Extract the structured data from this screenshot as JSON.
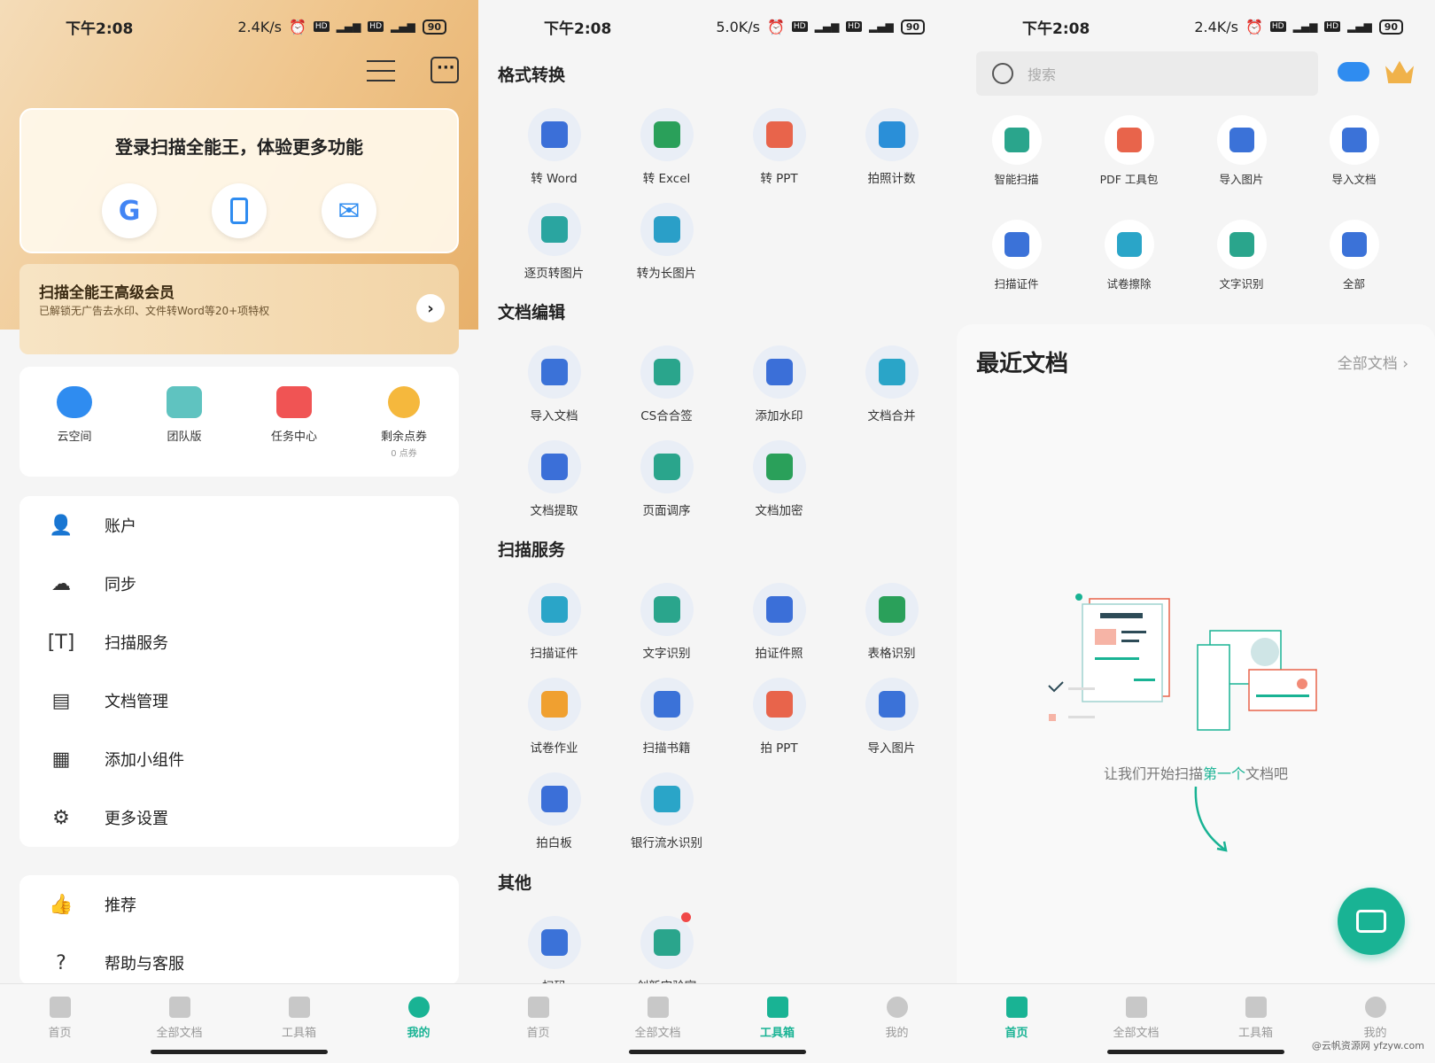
{
  "screen1": {
    "status": {
      "time": "下午2:08",
      "speed": "2.4K/s",
      "battery": "90"
    },
    "login": {
      "title": "登录扫描全能王，体验更多功能",
      "google": "G"
    },
    "vip": {
      "title": "扫描全能王高级会员",
      "subtitle": "已解锁无广告去水印、文件转Word等20+项特权"
    },
    "quick": [
      {
        "label": "云空间",
        "icon": "cloud-upload-icon",
        "color": "#2f8cf0"
      },
      {
        "label": "团队版",
        "icon": "team-folder-icon",
        "color": "#5fc3c0"
      },
      {
        "label": "任务中心",
        "icon": "task-check-icon",
        "color": "#f05454"
      },
      {
        "label": "剩余点券",
        "sub": "0 点券",
        "icon": "coupon-icon",
        "color": "#f5b83d"
      }
    ],
    "menu": [
      "账户",
      "同步",
      "扫描服务",
      "文档管理",
      "添加小组件",
      "更多设置"
    ],
    "menu2": [
      "推荐",
      "帮助与客服"
    ],
    "active_tab": "我的"
  },
  "screen2": {
    "status": {
      "time": "下午2:08",
      "speed": "5.0K/s",
      "battery": "90"
    },
    "sections": [
      {
        "title": "格式转换",
        "items": [
          {
            "label": "转 Word",
            "color": "#3b6fd8"
          },
          {
            "label": "转 Excel",
            "color": "#2aa05a"
          },
          {
            "label": "转 PPT",
            "color": "#e8644b"
          },
          {
            "label": "拍照计数",
            "color": "#2a8fd8"
          },
          {
            "label": "逐页转图片",
            "color": "#2aa5a0"
          },
          {
            "label": "转为长图片",
            "color": "#2a9fc8"
          }
        ]
      },
      {
        "title": "文档编辑",
        "items": [
          {
            "label": "导入文档",
            "color": "#3b72d8"
          },
          {
            "label": "CS合合签",
            "color": "#2aa58c"
          },
          {
            "label": "添加水印",
            "color": "#3b6fd8"
          },
          {
            "label": "文档合并",
            "color": "#2aa5c8"
          },
          {
            "label": "文档提取",
            "color": "#3b6fd8"
          },
          {
            "label": "页面调序",
            "color": "#2aa58c"
          },
          {
            "label": "文档加密",
            "color": "#2aa05a"
          }
        ]
      },
      {
        "title": "扫描服务",
        "items": [
          {
            "label": "扫描证件",
            "color": "#2aa5c8"
          },
          {
            "label": "文字识别",
            "color": "#2aa58c"
          },
          {
            "label": "拍证件照",
            "color": "#3b6fd8"
          },
          {
            "label": "表格识别",
            "color": "#2aa05a"
          },
          {
            "label": "试卷作业",
            "color": "#f0a030"
          },
          {
            "label": "扫描书籍",
            "color": "#3b72d8"
          },
          {
            "label": "拍 PPT",
            "color": "#e8644b"
          },
          {
            "label": "导入图片",
            "color": "#3b72d8"
          },
          {
            "label": "拍白板",
            "color": "#3b6fd8"
          },
          {
            "label": "银行流水识别",
            "color": "#2aa5c8"
          }
        ]
      },
      {
        "title": "其他",
        "items": [
          {
            "label": "扫码",
            "color": "#3b72d8"
          },
          {
            "label": "创新实验室",
            "color": "#2aa58c"
          }
        ]
      }
    ],
    "active_tab": "工具箱"
  },
  "screen3": {
    "status": {
      "time": "下午2:08",
      "speed": "2.4K/s",
      "battery": "90"
    },
    "search": {
      "placeholder": "搜索"
    },
    "tools": [
      {
        "label": "智能扫描",
        "color": "#2aa58c"
      },
      {
        "label": "PDF 工具包",
        "color": "#e8644b"
      },
      {
        "label": "导入图片",
        "color": "#3b72d8"
      },
      {
        "label": "导入文档",
        "color": "#3b72d8"
      },
      {
        "label": "扫描证件",
        "color": "#3b72d8"
      },
      {
        "label": "试卷擦除",
        "color": "#2aa5c8"
      },
      {
        "label": "文字识别",
        "color": "#2aa58c"
      },
      {
        "label": "全部",
        "color": "#3b72d8"
      }
    ],
    "recent": {
      "title": "最近文档",
      "all_link": "全部文档",
      "empty_pre": "让我们开始扫描",
      "empty_em": "第一个",
      "empty_post": "文档吧"
    },
    "active_tab": "首页",
    "watermark": "@云帆资源网 yfzyw.com"
  },
  "nav": [
    "首页",
    "全部文档",
    "工具箱",
    "我的"
  ],
  "colors": {
    "accent": "#19b394",
    "gold": "#efc48a"
  }
}
